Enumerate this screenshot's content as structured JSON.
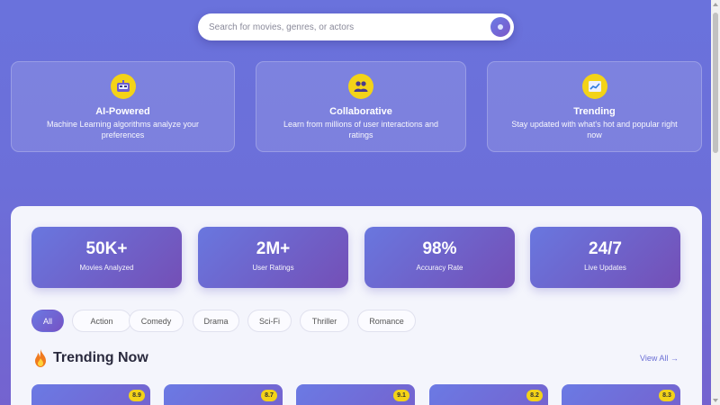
{
  "search": {
    "placeholder": "Search for movies, genres, or actors"
  },
  "features": [
    {
      "icon": "robot-icon",
      "title": "AI-Powered",
      "description": "Machine Learning algorithms analyze your preferences"
    },
    {
      "icon": "people-icon",
      "title": "Collaborative",
      "description": "Learn from millions of user interactions and ratings"
    },
    {
      "icon": "chart-icon",
      "title": "Trending",
      "description": "Stay updated with what's hot and popular right now"
    }
  ],
  "stats": [
    {
      "value": "50K+",
      "label": "Movies Analyzed"
    },
    {
      "value": "2M+",
      "label": "User Ratings"
    },
    {
      "value": "98%",
      "label": "Accuracy Rate"
    },
    {
      "value": "24/7",
      "label": "Live Updates"
    }
  ],
  "genres": {
    "selected": "All",
    "items": [
      "All",
      "Action",
      "Comedy",
      "Drama",
      "Sci-Fi",
      "Thriller",
      "Romance"
    ]
  },
  "trending": {
    "title": "Trending Now",
    "view_all": "View All →",
    "ratings": [
      "8.9",
      "8.7",
      "9.1",
      "8.2",
      "8.3"
    ]
  },
  "colors": {
    "accent": "#6b6fd5",
    "badge": "#f3d318",
    "gradient_start": "#6977df",
    "gradient_end": "#744fb6"
  }
}
